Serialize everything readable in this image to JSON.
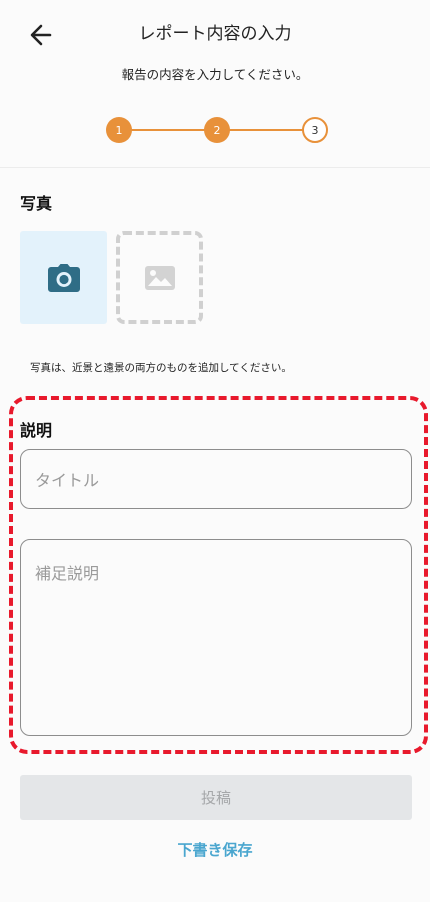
{
  "header": {
    "title": "レポート内容の入力",
    "subtitle": "報告の内容を入力してください。",
    "steps": [
      "1",
      "2",
      "3"
    ],
    "current_step": 3
  },
  "photo": {
    "section_title": "写真",
    "note": "写真は、近景と遠景の両方のものを追加してください。"
  },
  "description": {
    "section_title": "説明",
    "title_placeholder": "タイトル",
    "detail_placeholder": "補足説明"
  },
  "actions": {
    "post_label": "投稿",
    "draft_label": "下書き保存"
  },
  "colors": {
    "accent_orange": "#e8913a",
    "highlight_red": "#e8192c",
    "link_blue": "#4aa6cf",
    "camera_teal": "#2f6d86"
  }
}
